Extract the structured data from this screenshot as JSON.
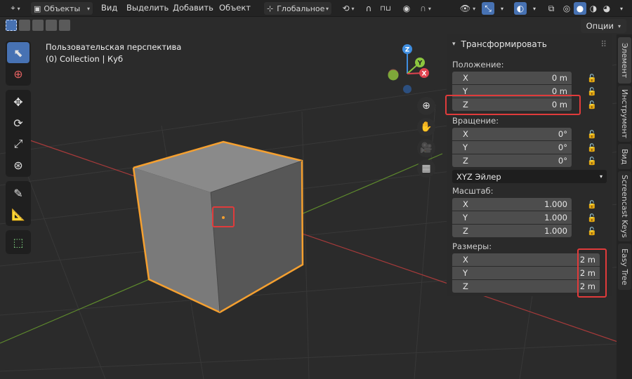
{
  "header": {
    "mode": "Объекты",
    "menus": [
      "Вид",
      "Выделить",
      "Добавить",
      "Объект"
    ],
    "orientation": "Глобальное"
  },
  "subrow": {
    "options": "Опции"
  },
  "viewport": {
    "title": "Пользовательская перспектива",
    "collection": "(0) Collection | Куб"
  },
  "gizmo": {
    "x": "X",
    "y": "Y",
    "z": "Z"
  },
  "panel": {
    "title": "Трансформировать",
    "location": {
      "label": "Положение:",
      "x_label": "X",
      "x": "0 m",
      "y_label": "Y",
      "y": "0 m",
      "z_label": "Z",
      "z": "0 m"
    },
    "rotation": {
      "label": "Вращение:",
      "x_label": "X",
      "x": "0°",
      "y_label": "Y",
      "y": "0°",
      "z_label": "Z",
      "z": "0°",
      "mode": "XYZ Эйлер"
    },
    "scale": {
      "label": "Масштаб:",
      "x_label": "X",
      "x": "1.000",
      "y_label": "Y",
      "y": "1.000",
      "z_label": "Z",
      "z": "1.000"
    },
    "dimensions": {
      "label": "Размеры:",
      "x_label": "X",
      "x": "2 m",
      "y_label": "Y",
      "y": "2 m",
      "z_label": "Z",
      "z": "2 m"
    }
  },
  "tabs": [
    "Элемент",
    "Инструмент",
    "Вид",
    "Screencast Keys",
    "Easy Tree"
  ],
  "colors": {
    "accent": "#4772b3",
    "highlight": "#e03b3b",
    "selection": "#f5a030",
    "x_axis": "#e0434f",
    "y_axis": "#8cc63f",
    "z_axis": "#3f8ee0"
  }
}
